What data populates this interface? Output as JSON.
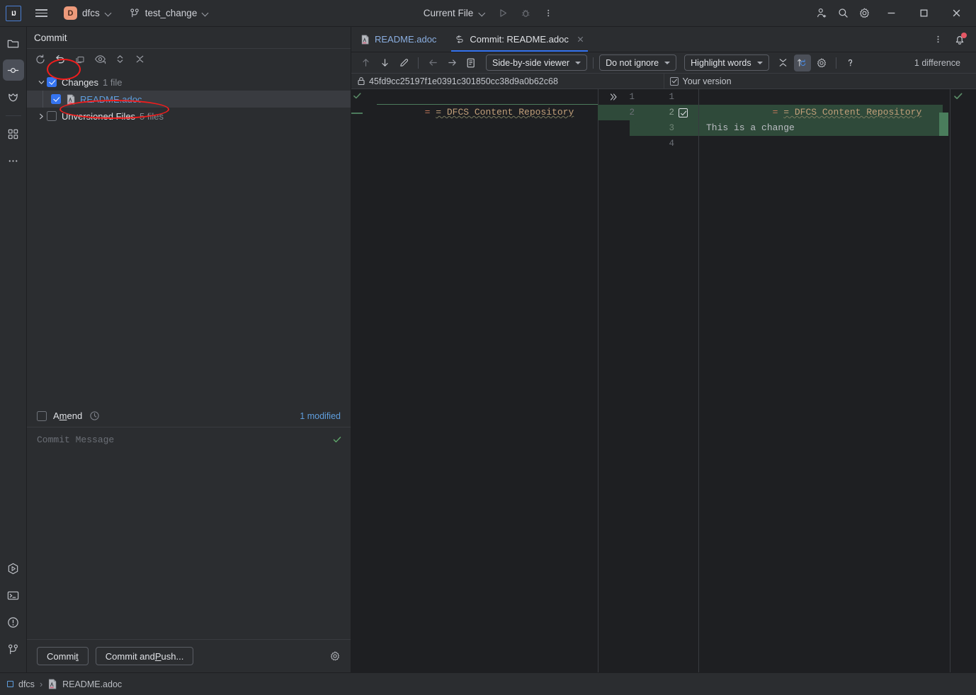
{
  "titlebar": {
    "logo": "IJ",
    "logo_icon": "intellij-logo-icon",
    "menu_icon": "hamburger-menu-icon",
    "project_badge": "D",
    "project_name": "dfcs",
    "branch_icon": "git-branch-icon",
    "branch_name": "test_change",
    "run_config": "Current File",
    "run_icon": "run-play-icon",
    "debug_icon": "debug-bug-icon",
    "more_icon": "more-vertical-icon",
    "account_icon": "add-user-icon",
    "search_icon": "search-icon",
    "settings_icon": "gear-icon",
    "minimize_icon": "minimize-icon",
    "maximize_icon": "maximize-icon",
    "close_icon": "close-icon"
  },
  "stripe": {
    "items": [
      {
        "name": "project-folder-icon",
        "title": "Project",
        "active": false
      },
      {
        "name": "commit-icon",
        "title": "Commit",
        "active": true
      },
      {
        "name": "pull-requests-icon",
        "title": "Pull Requests",
        "active": false
      },
      {
        "name": "plugins-icon",
        "title": "Plugins",
        "active": false
      },
      {
        "name": "more-tool-windows-icon",
        "title": "More",
        "active": false
      }
    ],
    "bottom_items": [
      {
        "name": "run-tool-icon",
        "title": "Run"
      },
      {
        "name": "terminal-icon",
        "title": "Terminal"
      },
      {
        "name": "problems-icon",
        "title": "Problems"
      },
      {
        "name": "version-control-icon",
        "title": "Version Control"
      }
    ]
  },
  "commit": {
    "title": "Commit",
    "toolbar": [
      {
        "name": "refresh-changes-icon",
        "title": "Refresh"
      },
      {
        "name": "rollback-icon",
        "title": "Rollback"
      },
      {
        "name": "shelve-icon",
        "title": "Shelve Silently"
      },
      {
        "name": "preview-diff-icon",
        "title": "Preview Diff"
      },
      {
        "name": "expand-collapse-icon",
        "title": "Expand/Collapse"
      },
      {
        "name": "collapse-all-icon",
        "title": "Collapse All"
      }
    ],
    "tree": [
      {
        "label": "Changes",
        "count": "1 file",
        "checked": true,
        "expanded": true,
        "type": "group"
      },
      {
        "label": "README.adoc",
        "checked": true,
        "type": "file",
        "selected": true,
        "icon": "asciidoc-file-icon"
      },
      {
        "label": "Unversioned Files",
        "count": "5 files",
        "checked": false,
        "expanded": false,
        "type": "group"
      }
    ],
    "amend_label_pre": "A",
    "amend_label_mnemonic": "m",
    "amend_label_post": "end",
    "amend_checked": false,
    "history_icon": "clock-history-icon",
    "modified_text": "1 modified",
    "message_placeholder": "Commit Message",
    "message_value": "",
    "message_ok_icon": "checkmark-icon",
    "commit_button": "Commit",
    "commit_button_mnemonic": "t",
    "commit_push_button_pre": "Commit and ",
    "commit_push_button_mnemonic": "P",
    "commit_push_button_post": "ush...",
    "settings_icon": "gear-icon"
  },
  "editor": {
    "tabs": [
      {
        "label": "README.adoc",
        "icon": "asciidoc-file-icon",
        "selected": false,
        "closable": false
      },
      {
        "label": "Commit: README.adoc",
        "icon": "diff-icon",
        "selected": true,
        "closable": true
      }
    ],
    "tab_options_icon": "more-vertical-icon",
    "notifications_icon": "bell-icon",
    "difftoolbar": {
      "prev_diff_icon": "arrow-up-icon",
      "next_diff_icon": "arrow-down-icon",
      "edit_icon": "pencil-icon",
      "accept_left_icon": "arrow-left-icon",
      "accept_right_icon": "arrow-right-icon",
      "annotate_icon": "annotate-icon",
      "viewer_mode": "Side-by-side viewer",
      "ignore_mode": "Do not ignore",
      "highlight_mode": "Highlight words",
      "collapse_unchanged_icon": "collapse-x-icon",
      "synchronize_icon": "sync-scroll-icon",
      "settings_icon": "gear-icon",
      "help_icon": "help-question-icon",
      "difference_count": "1 difference"
    },
    "diff": {
      "left_title": "45fd9cc25197f1e0391c301850cc38d9a0b62c68",
      "left_lock_icon": "lock-icon",
      "right_title": "Your version",
      "right_checked": true,
      "left_lines": [
        {
          "number": "1",
          "text": "= DFCS Content Repository",
          "type": "context"
        },
        {
          "number": "",
          "text": "",
          "type": "deleted-marker"
        }
      ],
      "right_lines": [
        {
          "number": "1",
          "text": "= DFCS Content Repository",
          "type": "context"
        },
        {
          "number": "2",
          "text": "",
          "type": "added"
        },
        {
          "number": "3",
          "text": "This is a change",
          "type": "added"
        },
        {
          "number": "4",
          "text": "",
          "type": "empty"
        }
      ],
      "gutter_left_number": "1",
      "gutter_left_change": "2",
      "gutter_change_icon": "chevron-double-right-icon",
      "accept_change_icon": "accept-change-checkbox"
    }
  },
  "status": {
    "project_icon": "project-square-icon",
    "project": "dfcs",
    "separator": "›",
    "file_icon": "asciidoc-file-icon",
    "file": "README.adoc"
  },
  "annotations": [
    {
      "name": "rollback-button-highlight"
    },
    {
      "name": "readme-file-row-highlight"
    }
  ],
  "colors": {
    "accent": "#3574f0",
    "link": "#5f9ede",
    "annotation": "#f01d1d",
    "added_bg": "#2f4a3a",
    "added_strong": "#4a7d5c",
    "window_bg": "#2b2d30",
    "editor_bg": "#1e1f22"
  }
}
